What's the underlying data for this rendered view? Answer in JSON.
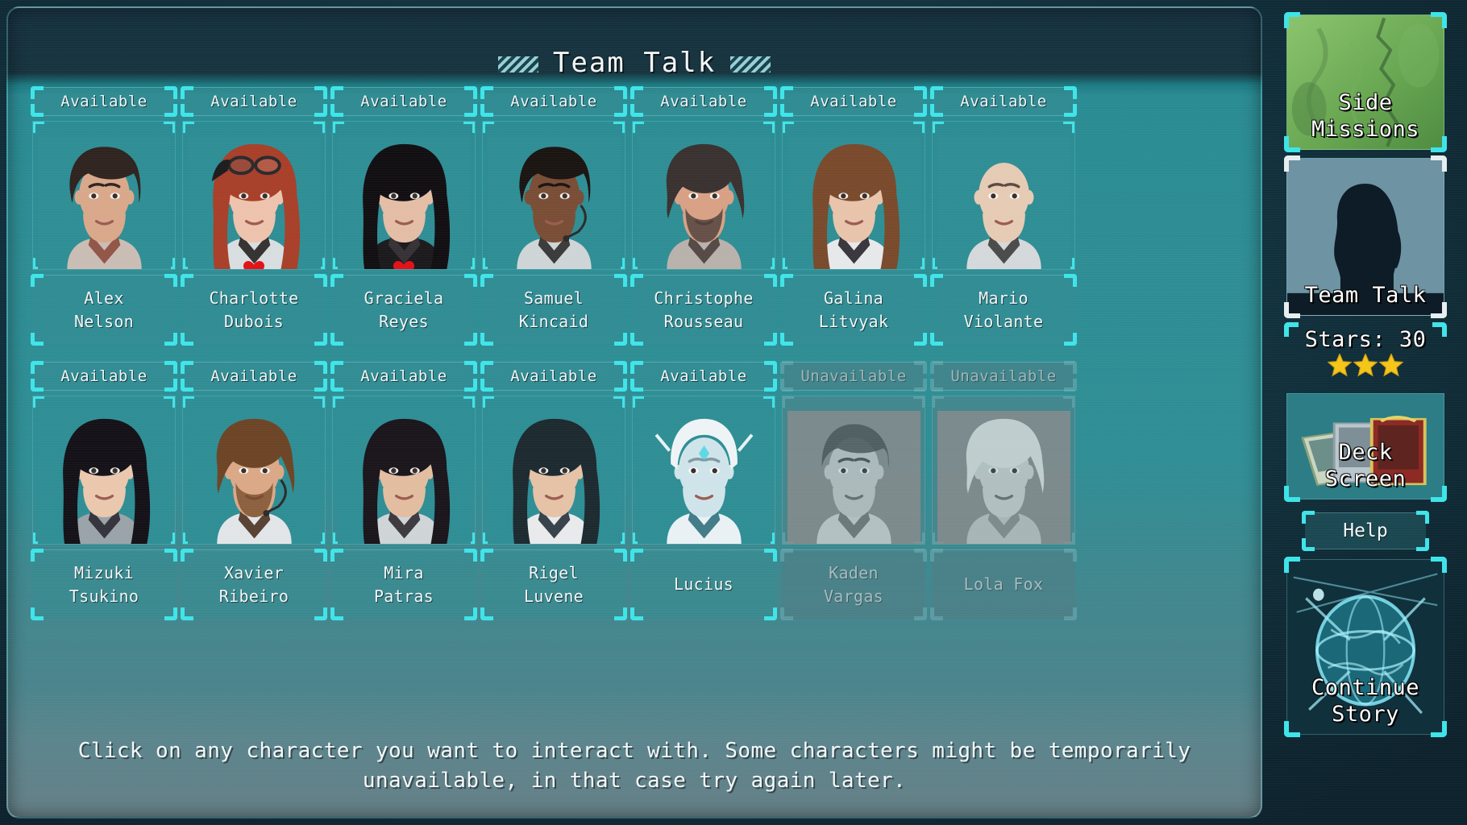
{
  "header": {
    "title": "Team Talk",
    "hatch_icon": "diagonal-hatch-decoration"
  },
  "footer": {
    "hint": "Click on any character you want to interact with. Some characters might be temporarily unavailable, in that case try again later."
  },
  "colors": {
    "accent_cyan": "#3fe4e8",
    "panel_teal": "#2e8d94",
    "panel_dark": "#16313f",
    "heart_red": "#e51319",
    "star_gold": "#f5c518",
    "text_light": "#f2f7f8",
    "text_dim": "#a5bbbf",
    "active_bracket": "#e7eef0"
  },
  "status_labels": {
    "available": "Available",
    "unavailable": "Unavailable"
  },
  "characters": {
    "row1": [
      {
        "name": "Alex\nNelson",
        "status": "Available",
        "available": true,
        "heart": false,
        "portrait": "alex"
      },
      {
        "name": "Charlotte\nDubois",
        "status": "Available",
        "available": true,
        "heart": true,
        "portrait": "charlotte"
      },
      {
        "name": "Graciela\nReyes",
        "status": "Available",
        "available": true,
        "heart": true,
        "portrait": "graciela"
      },
      {
        "name": "Samuel\nKincaid",
        "status": "Available",
        "available": true,
        "heart": false,
        "portrait": "samuel"
      },
      {
        "name": "Christophe\nRousseau",
        "status": "Available",
        "available": true,
        "heart": false,
        "portrait": "christophe"
      },
      {
        "name": "Galina\nLitvyak",
        "status": "Available",
        "available": true,
        "heart": false,
        "portrait": "galina"
      },
      {
        "name": "Mario\nViolante",
        "status": "Available",
        "available": true,
        "heart": false,
        "portrait": "mario"
      }
    ],
    "row2": [
      {
        "name": "Mizuki\nTsukino",
        "status": "Available",
        "available": true,
        "heart": false,
        "portrait": "mizuki"
      },
      {
        "name": "Xavier\nRibeiro",
        "status": "Available",
        "available": true,
        "heart": false,
        "portrait": "xavier"
      },
      {
        "name": "Mira\nPatras",
        "status": "Available",
        "available": true,
        "heart": false,
        "portrait": "mira"
      },
      {
        "name": "Rigel\nLuvene",
        "status": "Available",
        "available": true,
        "heart": false,
        "portrait": "rigel"
      },
      {
        "name": "Lucius",
        "status": "Available",
        "available": true,
        "heart": false,
        "portrait": "lucius"
      },
      {
        "name": "Kaden\nVargas",
        "status": "Unavailable",
        "available": false,
        "heart": false,
        "portrait": "kaden"
      },
      {
        "name": "Lola Fox",
        "status": "Unavailable",
        "available": false,
        "heart": false,
        "portrait": "lola"
      }
    ]
  },
  "sidebar": {
    "side_missions": {
      "label": "Side\nMissions",
      "art": "green-terrain-map"
    },
    "team_talk": {
      "label": "Team Talk",
      "art": "character-silhouette",
      "active": true
    },
    "stars": {
      "label": "Stars: 30",
      "count": 3,
      "star_icon": "star-icon"
    },
    "deck_screen": {
      "label": "Deck\nScreen",
      "art": "playing-cards"
    },
    "help": {
      "label": "Help"
    },
    "continue_story": {
      "label": "Continue\nStory",
      "art": "cyan-planet-globe"
    }
  }
}
